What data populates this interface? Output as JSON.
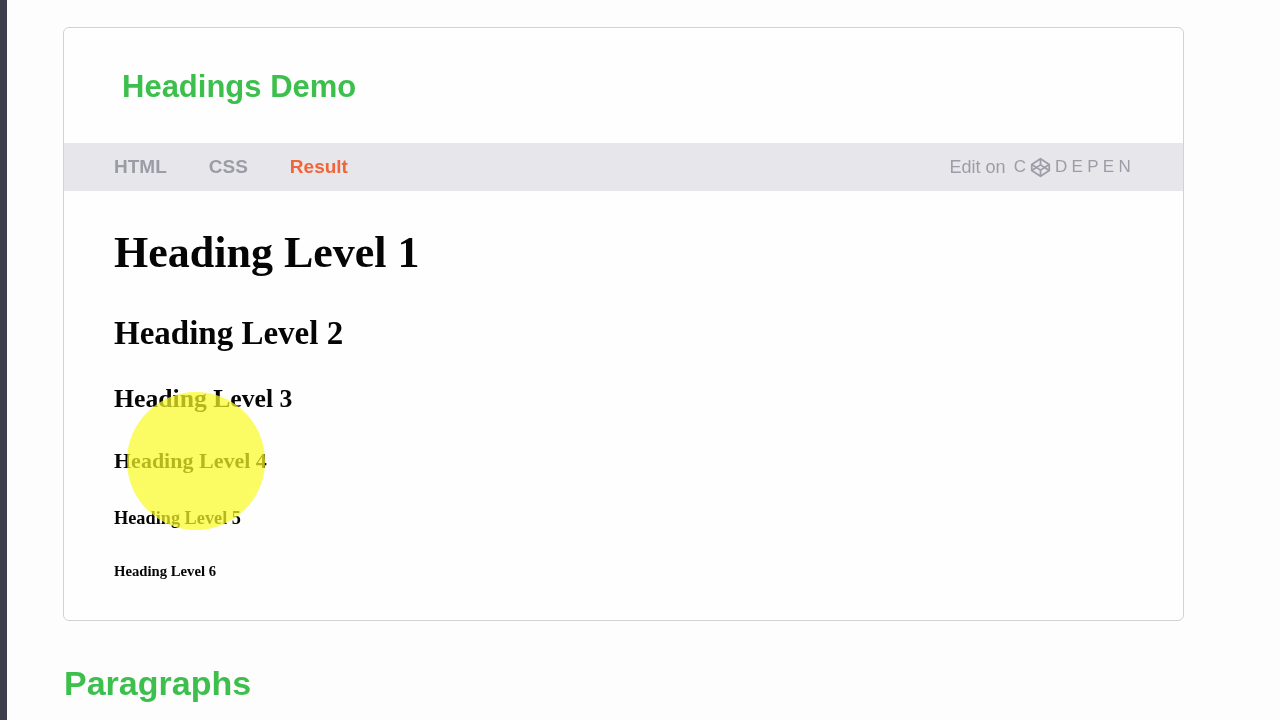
{
  "header": {
    "title": "Headings Demo"
  },
  "tabs": [
    {
      "label": "HTML",
      "selected": false
    },
    {
      "label": "CSS",
      "selected": false
    },
    {
      "label": "Result",
      "selected": true
    }
  ],
  "edit_link": {
    "label": "Edit on",
    "brand_start": "C",
    "brand_end": "DEPEN"
  },
  "result": {
    "headings": [
      {
        "kind": "h1",
        "text": "Heading Level 1"
      },
      {
        "kind": "h2",
        "text": "Heading Level 2"
      },
      {
        "kind": "h3",
        "text": "Heading Level 3"
      },
      {
        "kind": "h4",
        "text": "Heading Level 4"
      },
      {
        "kind": "h5",
        "text": "Heading Level 5"
      },
      {
        "kind": "h6",
        "text": "Heading Level 6"
      }
    ]
  },
  "next_section": {
    "title": "Paragraphs"
  }
}
